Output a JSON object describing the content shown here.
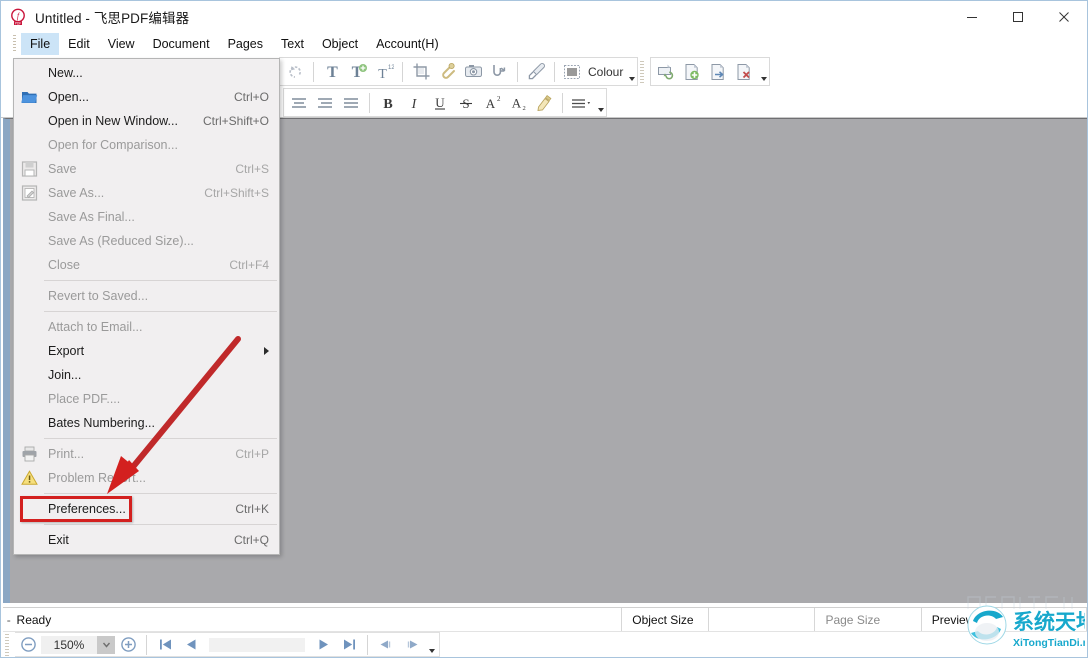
{
  "window": {
    "title": "Untitled - 飞思PDF编辑器",
    "app_icon": "pdf-app-icon",
    "controls": {
      "minimize": "—",
      "maximize": "□",
      "close": "✕"
    }
  },
  "menubar": {
    "items": [
      {
        "label": "File",
        "active": true
      },
      {
        "label": "Edit",
        "active": false
      },
      {
        "label": "View",
        "active": false
      },
      {
        "label": "Document",
        "active": false
      },
      {
        "label": "Pages",
        "active": false
      },
      {
        "label": "Text",
        "active": false
      },
      {
        "label": "Object",
        "active": false
      },
      {
        "label": "Account(H)",
        "active": false
      }
    ]
  },
  "toolbar": {
    "row1": [
      {
        "icon": "undo-icon",
        "name": "undo"
      },
      {
        "icon": "text-tool-icon",
        "name": "add-text"
      },
      {
        "icon": "text-edit-icon",
        "name": "edit-text"
      },
      {
        "icon": "text-number-icon",
        "name": "number-text"
      },
      {
        "icon": "crop-icon",
        "name": "crop"
      },
      {
        "icon": "attachment-icon",
        "name": "attachment"
      },
      {
        "icon": "camera-icon",
        "name": "snapshot"
      },
      {
        "icon": "stamp-icon",
        "name": "stamp"
      },
      {
        "icon": "eyedropper-icon",
        "name": "eyedropper"
      },
      {
        "icon": "colour-swatch-icon",
        "name": "colour"
      }
    ],
    "colour_label": "Colour",
    "row1_right": [
      {
        "icon": "page-refresh-icon",
        "name": "refresh-page"
      },
      {
        "icon": "page-add-icon",
        "name": "insert-page"
      },
      {
        "icon": "page-extract-icon",
        "name": "extract-page"
      },
      {
        "icon": "page-delete-icon",
        "name": "delete-page"
      }
    ],
    "row2": [
      {
        "icon": "align-left-icon",
        "name": "align-left"
      },
      {
        "icon": "align-center-icon",
        "name": "align-center"
      },
      {
        "icon": "align-justify-icon",
        "name": "align-justify"
      },
      {
        "icon": "bold-icon",
        "name": "bold",
        "glyph": "B"
      },
      {
        "icon": "italic-icon",
        "name": "italic",
        "glyph": "I"
      },
      {
        "icon": "underline-icon",
        "name": "underline",
        "glyph": "U"
      },
      {
        "icon": "strikethrough-icon",
        "name": "strikethrough",
        "glyph": "S"
      },
      {
        "icon": "superscript-icon",
        "name": "superscript",
        "glyph": "A"
      },
      {
        "icon": "subscript-icon",
        "name": "subscript",
        "glyph": "A"
      },
      {
        "icon": "highlight-pen-icon",
        "name": "highlight"
      },
      {
        "icon": "line-spacing-icon",
        "name": "line-spacing"
      }
    ]
  },
  "file_menu": {
    "items": [
      {
        "label": "New...",
        "shortcut": "",
        "disabled": false,
        "icon": "",
        "sep_after": false,
        "submenu": false
      },
      {
        "label": "Open...",
        "shortcut": "Ctrl+O",
        "disabled": false,
        "icon": "open-folder-icon",
        "sep_after": false,
        "submenu": false
      },
      {
        "label": "Open in New Window...",
        "shortcut": "Ctrl+Shift+O",
        "disabled": false,
        "icon": "",
        "sep_after": false,
        "submenu": false
      },
      {
        "label": "Open for Comparison...",
        "shortcut": "",
        "disabled": true,
        "icon": "",
        "sep_after": false,
        "submenu": false
      },
      {
        "label": "Save",
        "shortcut": "Ctrl+S",
        "disabled": true,
        "icon": "save-disk-icon",
        "sep_after": false,
        "submenu": false
      },
      {
        "label": "Save As...",
        "shortcut": "Ctrl+Shift+S",
        "disabled": true,
        "icon": "save-as-icon",
        "sep_after": false,
        "submenu": false
      },
      {
        "label": "Save As Final...",
        "shortcut": "",
        "disabled": true,
        "icon": "",
        "sep_after": false,
        "submenu": false
      },
      {
        "label": "Save As (Reduced Size)...",
        "shortcut": "",
        "disabled": true,
        "icon": "",
        "sep_after": false,
        "submenu": false
      },
      {
        "label": "Close",
        "shortcut": "Ctrl+F4",
        "disabled": true,
        "icon": "",
        "sep_after": true,
        "submenu": false
      },
      {
        "label": "Revert to Saved...",
        "shortcut": "",
        "disabled": true,
        "icon": "",
        "sep_after": true,
        "submenu": false
      },
      {
        "label": "Attach to Email...",
        "shortcut": "",
        "disabled": true,
        "icon": "",
        "sep_after": false,
        "submenu": false
      },
      {
        "label": "Export",
        "shortcut": "",
        "disabled": false,
        "icon": "",
        "sep_after": false,
        "submenu": true
      },
      {
        "label": "Join...",
        "shortcut": "",
        "disabled": false,
        "icon": "",
        "sep_after": false,
        "submenu": false
      },
      {
        "label": "Place PDF....",
        "shortcut": "",
        "disabled": true,
        "icon": "",
        "sep_after": false,
        "submenu": false
      },
      {
        "label": "Bates Numbering...",
        "shortcut": "",
        "disabled": false,
        "icon": "",
        "sep_after": true,
        "submenu": false
      },
      {
        "label": "Print...",
        "shortcut": "Ctrl+P",
        "disabled": true,
        "icon": "printer-icon",
        "sep_after": false,
        "submenu": false
      },
      {
        "label": "Problem Report...",
        "shortcut": "",
        "disabled": true,
        "icon": "warning-icon",
        "sep_after": true,
        "submenu": false
      },
      {
        "label": "Preferences...",
        "shortcut": "Ctrl+K",
        "disabled": false,
        "icon": "",
        "sep_after": true,
        "submenu": false
      },
      {
        "label": "Exit",
        "shortcut": "Ctrl+Q",
        "disabled": false,
        "icon": "",
        "sep_after": false,
        "submenu": false
      }
    ],
    "highlighted_item": "Preferences..."
  },
  "annotation": {
    "color": "#d3201f",
    "target_label": "Preferences...",
    "arrow": "red-arrow-pointer"
  },
  "statusbar": {
    "handle": "-",
    "ready": "Ready",
    "object_size_label": "Object Size",
    "object_size_value": "",
    "page_size_label": "Page Size",
    "preview_label": "Preview"
  },
  "bottombar": {
    "zoom_out": "zoom-out-icon",
    "zoom_value": "150%",
    "zoom_in": "zoom-in-icon",
    "page_value": "",
    "nav": [
      {
        "icon": "first-page-icon",
        "name": "first-page"
      },
      {
        "icon": "prev-page-icon",
        "name": "previous-page"
      },
      {
        "icon": "next-page-icon",
        "name": "next-page"
      },
      {
        "icon": "last-page-icon",
        "name": "last-page"
      },
      {
        "icon": "back-view-icon",
        "name": "previous-view"
      },
      {
        "icon": "forward-view-icon",
        "name": "next-view"
      }
    ]
  },
  "watermark": {
    "chinese": "系统天地",
    "latin": "XiTongTianDi.net",
    "brand_color": "#1aa6c8"
  },
  "colors": {
    "title_bg": "#ffffff",
    "menu_active": "#cce4f7",
    "doc_bg": "#a9a9ac",
    "menu_bg": "#f1eff0",
    "accent_red": "#d3201f"
  }
}
